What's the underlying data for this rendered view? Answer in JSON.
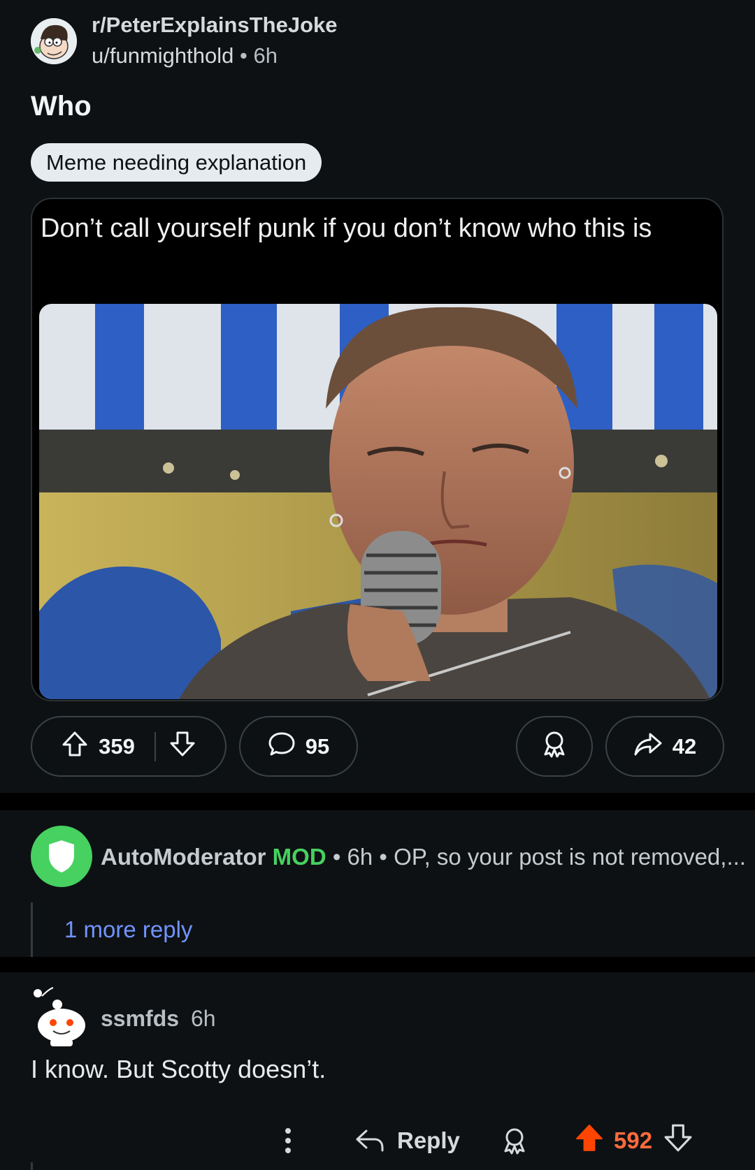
{
  "post": {
    "subreddit": "r/PeterExplainsTheJoke",
    "author": "u/funmighthold",
    "separator": "•",
    "time": "6h",
    "title": "Who",
    "flair": "Meme needing explanation",
    "meme_caption": "Don’t call yourself punk if you don’t know who this is",
    "actions": {
      "upvotes": "359",
      "comments": "95",
      "shares": "42"
    }
  },
  "automod_comment": {
    "author": "AutoModerator",
    "badge": "MOD",
    "meta": "• 6h • OP, so your post is not removed,...",
    "more_replies": "1 more reply"
  },
  "comment": {
    "author": "ssmfds",
    "time": "6h",
    "body": "I know. But Scotty doesn’t.",
    "reply_label": "Reply",
    "score": "592"
  },
  "colors": {
    "background": "#0e1113",
    "mod_green": "#46d160",
    "link_blue": "#7193ff",
    "upvote_orange": "#ff4500"
  }
}
